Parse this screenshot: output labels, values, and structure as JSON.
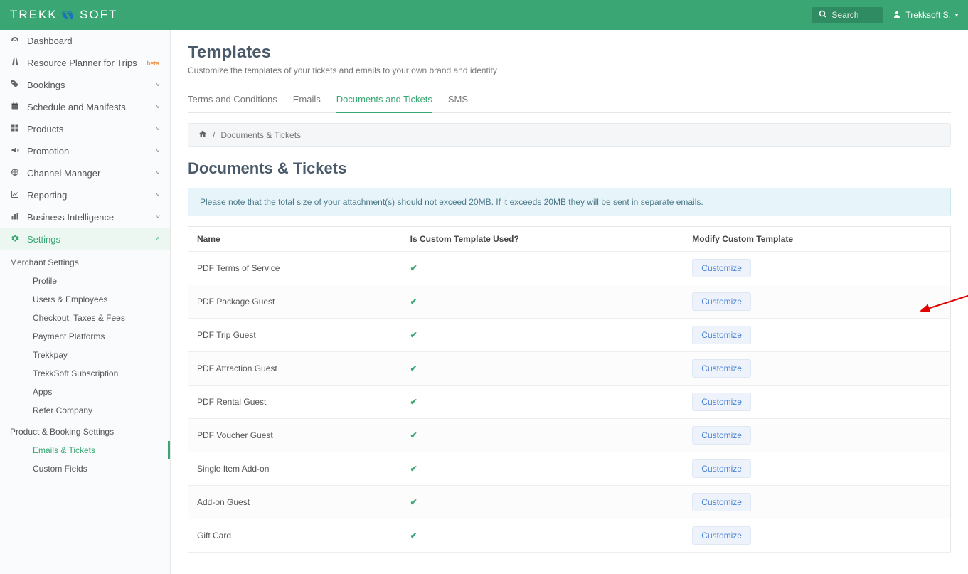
{
  "brand": {
    "name_a": "TREKK",
    "name_b": "SOFT"
  },
  "header": {
    "search_placeholder": "Search",
    "user_label": "Trekksoft S."
  },
  "sidebar": {
    "items": [
      {
        "icon": "tachometer",
        "label": "Dashboard",
        "expandable": false
      },
      {
        "icon": "road",
        "label": "Resource Planner for Trips",
        "beta": "beta",
        "expandable": false
      },
      {
        "icon": "tags",
        "label": "Bookings",
        "expandable": true
      },
      {
        "icon": "calendar",
        "label": "Schedule and Manifests",
        "expandable": true
      },
      {
        "icon": "th",
        "label": "Products",
        "expandable": true
      },
      {
        "icon": "bullhorn",
        "label": "Promotion",
        "expandable": true
      },
      {
        "icon": "globe",
        "label": "Channel Manager",
        "expandable": true
      },
      {
        "icon": "chart-line",
        "label": "Reporting",
        "expandable": true
      },
      {
        "icon": "chart-bar",
        "label": "Business Intelligence",
        "expandable": true
      },
      {
        "icon": "cog",
        "label": "Settings",
        "expandable": true,
        "active": true
      }
    ],
    "groups": [
      {
        "title": "Merchant Settings",
        "subs": [
          {
            "label": "Profile"
          },
          {
            "label": "Users & Employees"
          },
          {
            "label": "Checkout, Taxes & Fees"
          },
          {
            "label": "Payment Platforms"
          },
          {
            "label": "Trekkpay"
          },
          {
            "label": "TrekkSoft Subscription"
          },
          {
            "label": "Apps"
          },
          {
            "label": "Refer Company"
          }
        ]
      },
      {
        "title": "Product & Booking Settings",
        "subs": [
          {
            "label": "Emails & Tickets",
            "active": true
          },
          {
            "label": "Custom Fields"
          }
        ]
      }
    ]
  },
  "page": {
    "title": "Templates",
    "subtitle": "Customize the templates of your tickets and emails to your own brand and identity",
    "tabs": [
      {
        "label": "Terms and Conditions"
      },
      {
        "label": "Emails"
      },
      {
        "label": "Documents and Tickets",
        "active": true
      },
      {
        "label": "SMS"
      }
    ],
    "breadcrumb": {
      "current": "Documents & Tickets"
    },
    "section_title": "Documents & Tickets",
    "notice": "Please note that the total size of your attachment(s) should not exceed 20MB. If it exceeds 20MB they will be sent in separate emails.",
    "table": {
      "headers": {
        "name": "Name",
        "custom": "Is Custom Template Used?",
        "modify": "Modify Custom Template"
      },
      "customize_label": "Customize",
      "rows": [
        {
          "name": "PDF Terms of Service",
          "custom": true
        },
        {
          "name": "PDF Package Guest",
          "custom": true
        },
        {
          "name": "PDF Trip Guest",
          "custom": true
        },
        {
          "name": "PDF Attraction Guest",
          "custom": true
        },
        {
          "name": "PDF Rental Guest",
          "custom": true
        },
        {
          "name": "PDF Voucher Guest",
          "custom": true
        },
        {
          "name": "Single Item Add-on",
          "custom": true
        },
        {
          "name": "Add-on Guest",
          "custom": true
        },
        {
          "name": "Gift Card",
          "custom": true
        }
      ]
    }
  }
}
